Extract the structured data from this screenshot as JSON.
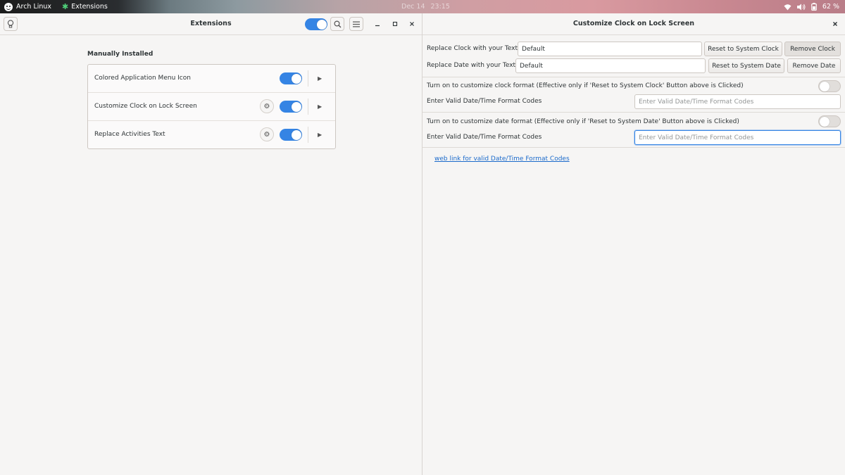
{
  "topbar": {
    "activities_label": "Arch Linux",
    "app_label": "Extensions",
    "date": "Dec 14",
    "time": "23:15",
    "battery": "62 %"
  },
  "extensions_window": {
    "title": "Extensions",
    "global_toggle_on": true,
    "section_title": "Manually Installed",
    "extensions": [
      {
        "name": "Colored Application Menu Icon",
        "has_settings": false,
        "enabled": true
      },
      {
        "name": "Customize Clock on Lock Screen",
        "has_settings": true,
        "enabled": true
      },
      {
        "name": "Replace Activities Text",
        "has_settings": true,
        "enabled": true
      }
    ]
  },
  "prefs_window": {
    "title": "Customize Clock on Lock Screen",
    "clock_label": "Replace Clock with your Text",
    "clock_value": "Default",
    "reset_clock_button": "Reset to System Clock",
    "remove_clock_button": "Remove Clock",
    "date_label": "Replace Date with your Text",
    "date_value": "Default",
    "reset_date_button": "Reset to System Date",
    "remove_date_button": "Remove Date",
    "clock_format_toggle_label": "Turn on to customize clock format (Effective only if 'Reset to System Clock' Button above is Clicked)",
    "clock_format_label": "Enter Valid Date/Time Format Codes",
    "clock_format_placeholder": "Enter Valid Date/Time Format Codes",
    "date_format_toggle_label": "Turn on to customize date format (Effective only if 'Reset to System Date' Button above is Clicked)",
    "date_format_label": "Enter Valid Date/Time Format Codes",
    "date_format_placeholder": "Enter Valid Date/Time Format Codes",
    "link_text": "web link for valid Date/Time Format Codes"
  }
}
